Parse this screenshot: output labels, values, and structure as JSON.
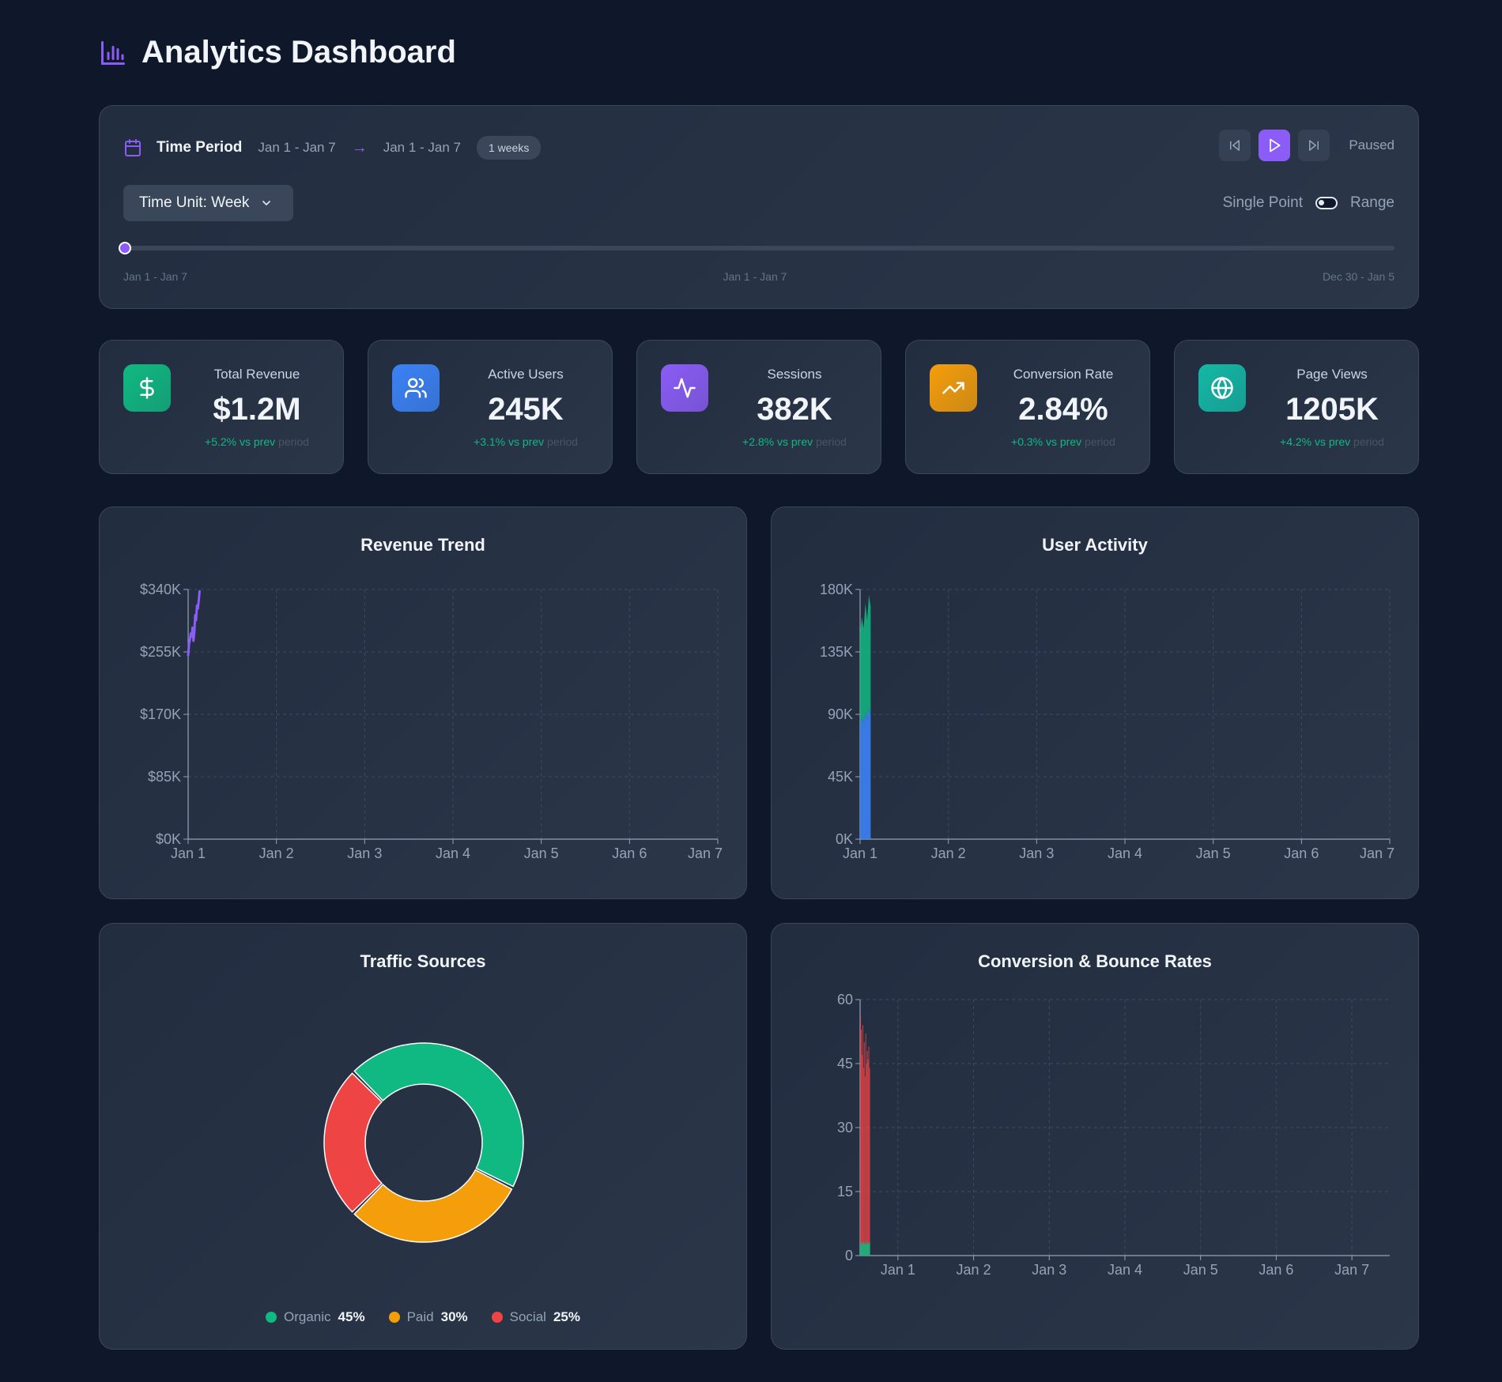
{
  "header": {
    "title": "Analytics Dashboard",
    "icon": "bar-chart-icon"
  },
  "time_period": {
    "label": "Time Period",
    "start": "Jan 1 - Jan 7",
    "end": "Jan 1 - Jan 7",
    "arrow": "→",
    "duration": "1 weeks",
    "status": "Paused",
    "unit_select": "Time Unit: Week",
    "mode_left": "Single Point",
    "mode_right": "Range",
    "slider_labels": [
      "Jan 1 - Jan 7",
      "Jan 1 - Jan 7",
      "Dec 30 - Jan 5"
    ],
    "slider_value": 0
  },
  "kpis": [
    {
      "label": "Total Revenue",
      "value": "$1.2M",
      "change": "+5.2% vs prev",
      "suffix": " period",
      "color": "#10b981",
      "icon": "dollar-icon"
    },
    {
      "label": "Active Users",
      "value": "245K",
      "change": "+3.1% vs prev",
      "suffix": " period",
      "color": "#3b82f6",
      "icon": "users-icon"
    },
    {
      "label": "Sessions",
      "value": "382K",
      "change": "+2.8% vs prev",
      "suffix": " period",
      "color": "#8b5cf6",
      "icon": "activity-icon"
    },
    {
      "label": "Conversion Rate",
      "value": "2.84%",
      "change": "+0.3% vs prev",
      "suffix": " period",
      "color": "#f59e0b",
      "icon": "trending-up-icon"
    },
    {
      "label": "Page Views",
      "value": "1205K",
      "change": "+4.2% vs prev",
      "suffix": " period",
      "color": "#14b8a6",
      "icon": "globe-icon"
    }
  ],
  "chart_data": [
    {
      "type": "line",
      "title": "Revenue Trend",
      "xlabel": "",
      "ylabel": "",
      "x_ticks": [
        "Jan 1",
        "Jan 2",
        "Jan 3",
        "Jan 4",
        "Jan 5",
        "Jan 6",
        "Jan 7"
      ],
      "y_ticks": [
        "$0K",
        "$85K",
        "$170K",
        "$255K",
        "$340K"
      ],
      "ylim": [
        0,
        340
      ],
      "xlim": [
        1,
        7
      ],
      "grid": true,
      "series": [
        {
          "color": "#8b5cf6",
          "x": [
            1,
            1.01,
            1.02,
            1.03,
            1.04,
            1.05,
            1.06,
            1.07,
            1.08,
            1.09,
            1.1,
            1.11,
            1.12,
            1.13
          ],
          "values": [
            250,
            265,
            272,
            280,
            276,
            288,
            270,
            282,
            305,
            298,
            318,
            314,
            325,
            338
          ]
        }
      ]
    },
    {
      "type": "area",
      "title": "User Activity",
      "xlabel": "",
      "ylabel": "",
      "x_ticks": [
        "Jan 1",
        "Jan 2",
        "Jan 3",
        "Jan 4",
        "Jan 5",
        "Jan 6",
        "Jan 7"
      ],
      "y_ticks": [
        "0K",
        "45K",
        "90K",
        "135K",
        "180K"
      ],
      "ylim": [
        0,
        180
      ],
      "xlim": [
        1,
        7
      ],
      "grid": true,
      "series": [
        {
          "color": "#3b82f6",
          "x": [
            1,
            1.02,
            1.04,
            1.06,
            1.08,
            1.1,
            1.12
          ],
          "values": [
            82,
            88,
            84,
            92,
            86,
            95,
            90
          ]
        },
        {
          "color": "#10b981",
          "x": [
            1,
            1.02,
            1.04,
            1.06,
            1.08,
            1.1,
            1.12
          ],
          "values": [
            148,
            160,
            152,
            170,
            158,
            176,
            168
          ]
        }
      ]
    },
    {
      "type": "pie",
      "title": "Traffic Sources",
      "series": [
        {
          "name": "Organic",
          "value": 45,
          "color": "#10b981",
          "label": "45%"
        },
        {
          "name": "Paid",
          "value": 30,
          "color": "#f59e0b",
          "label": "30%"
        },
        {
          "name": "Social",
          "value": 25,
          "color": "#ef4444",
          "label": "25%"
        }
      ]
    },
    {
      "type": "bar",
      "title": "Conversion & Bounce Rates",
      "xlabel": "",
      "ylabel": "",
      "x_ticks": [
        "Jan 1",
        "Jan 2",
        "Jan 3",
        "Jan 4",
        "Jan 5",
        "Jan 6",
        "Jan 7"
      ],
      "y_ticks": [
        "0",
        "15",
        "30",
        "45",
        "60"
      ],
      "ylim": [
        0,
        60
      ],
      "xlim": [
        0.5,
        7.5
      ],
      "grid": true,
      "series": [
        {
          "color": "#ef4444",
          "x": [
            0.5,
            0.51,
            0.52,
            0.53,
            0.54,
            0.55,
            0.56,
            0.57,
            0.58,
            0.59,
            0.6,
            0.61,
            0.62
          ],
          "values": [
            56,
            53,
            47,
            54,
            44,
            50,
            42,
            52,
            45,
            48,
            46,
            49,
            44
          ]
        },
        {
          "color": "#10b981",
          "x": [
            0.5,
            0.51,
            0.52,
            0.53,
            0.54,
            0.55,
            0.56,
            0.57,
            0.58,
            0.59,
            0.6,
            0.61,
            0.62
          ],
          "values": [
            2.6,
            3.1,
            2.4,
            2.9,
            3.2,
            2.7,
            3.0,
            2.5,
            2.8,
            3.3,
            2.6,
            2.9,
            3.1
          ]
        }
      ]
    }
  ]
}
